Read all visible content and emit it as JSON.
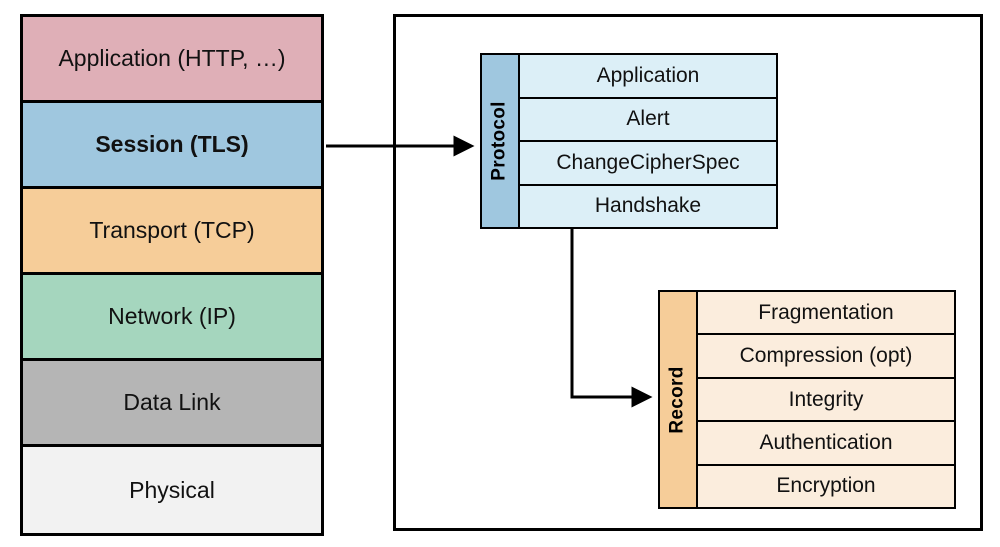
{
  "layers": {
    "application": "Application (HTTP, …)",
    "session": "Session (TLS)",
    "transport": "Transport (TCP)",
    "network": "Network (IP)",
    "datalink": "Data Link",
    "physical": "Physical"
  },
  "layer_colors": {
    "application": "#dfafb7",
    "session": "#9fc7df",
    "transport": "#f6cd99",
    "network": "#a5d6be",
    "datalink": "#b5b5b5",
    "physical": "#f2f2f2"
  },
  "protocol": {
    "label": "Protocol",
    "items": {
      "application": "Application",
      "alert": "Alert",
      "change_cipher_spec": "ChangeCipherSpec",
      "handshake": "Handshake"
    }
  },
  "record": {
    "label": "Record",
    "items": {
      "fragmentation": "Fragmentation",
      "compression": "Compression (opt)",
      "integrity": "Integrity",
      "authentication": "Authentication",
      "encryption": "Encryption"
    }
  }
}
